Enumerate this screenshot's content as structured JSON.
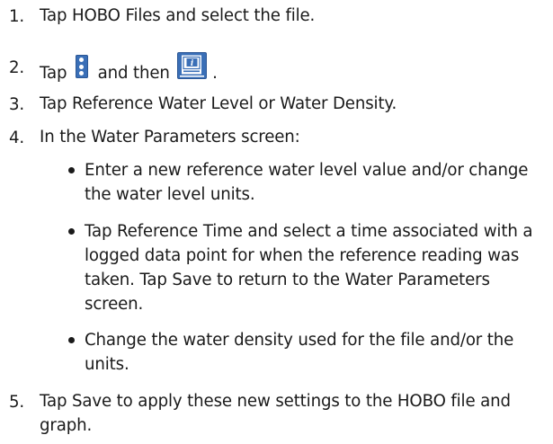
{
  "steps": [
    {
      "number": "1.",
      "text": "Tap HOBO Files and select the file."
    },
    {
      "number": "2.",
      "text_before": "Tap",
      "text_middle": "and then",
      "text_after": ".",
      "icons": [
        "vertical-ellipsis-menu-icon",
        "file-details-icon"
      ]
    },
    {
      "number": "3.",
      "text": "Tap Reference Water Level or Water Density."
    },
    {
      "number": "4.",
      "text": "In the Water Parameters screen:"
    },
    {
      "number": "5.",
      "text": "Tap Save to apply these new settings to the HOBO file and graph."
    }
  ],
  "bullets": [
    {
      "text": "Enter a new reference water level value and/or change the water level units."
    },
    {
      "text": "Tap Reference Time and select a time associated with a logged data point for when the reference reading was taken. Tap Save to return to the Water Parameters screen."
    },
    {
      "text": "Change the water density used for the file and/or the units."
    }
  ],
  "colors": {
    "text": "#1a1a1a",
    "icon_blue": "#3a6fb7"
  }
}
